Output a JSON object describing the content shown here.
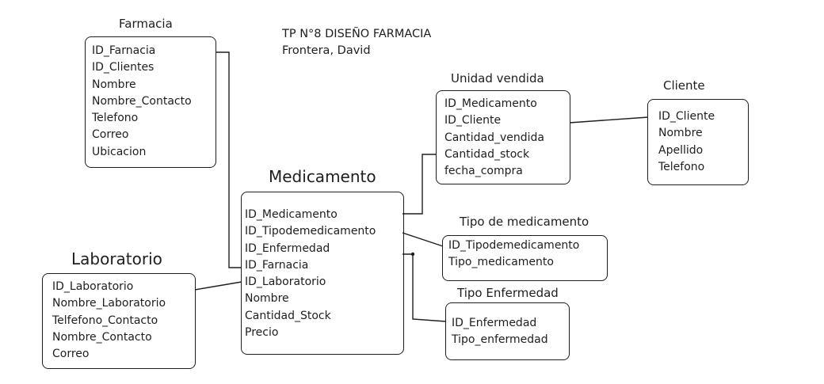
{
  "title": {
    "line1": "TP N°8 DISEÑO FARMACIA",
    "line2": "Frontera, David"
  },
  "entities": {
    "farmacia": {
      "name": "Farmacia",
      "fields": [
        "ID_Farnacia",
        "ID_Clientes",
        "Nombre",
        "Nombre_Contacto",
        "Telefono",
        "Correo",
        "Ubicacion"
      ]
    },
    "medicamento": {
      "name": "Medicamento",
      "fields": [
        "ID_Medicamento",
        "ID_Tipodemedicamento",
        "ID_Enfermedad",
        "ID_Farnacia",
        "ID_Laboratorio",
        "Nombre",
        "Cantidad_Stock",
        "Precio"
      ]
    },
    "laboratorio": {
      "name": "Laboratorio",
      "fields": [
        "ID_Laboratorio",
        "Nombre_Laboratorio",
        "Telfefono_Contacto",
        "Nombre_Contacto",
        "Correo"
      ]
    },
    "unidad_vendida": {
      "name": "Unidad vendida",
      "fields": [
        "ID_Medicamento",
        "ID_Cliente",
        "Cantidad_vendida",
        "Cantidad_stock",
        "fecha_compra"
      ]
    },
    "cliente": {
      "name": "Cliente",
      "fields": [
        "ID_Cliente",
        "Nombre",
        "Apellido",
        "Telefono"
      ]
    },
    "tipo_medicamento": {
      "name": "Tipo de medicamento",
      "fields": [
        "ID_Tipodemedicamento",
        "Tipo_medicamento"
      ]
    },
    "tipo_enfermedad": {
      "name": "Tipo Enfermedad",
      "fields": [
        "ID_Enfermedad",
        "Tipo_enfermedad"
      ]
    }
  }
}
